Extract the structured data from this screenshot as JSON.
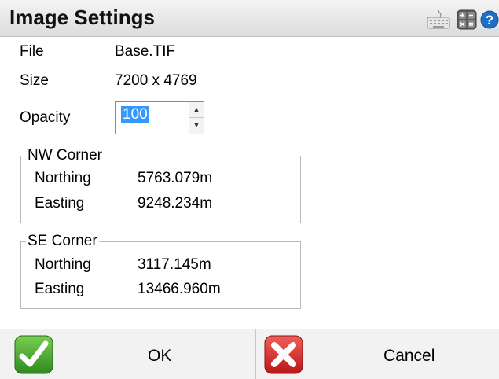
{
  "window": {
    "title": "Image Settings"
  },
  "info": {
    "file_label": "File",
    "file_value": "Base.TIF",
    "size_label": "Size",
    "size_value": "7200 x 4769"
  },
  "opacity": {
    "label": "Opacity",
    "value": "100",
    "up_glyph": "▲",
    "down_glyph": "▼"
  },
  "nw_corner": {
    "title": "NW Corner",
    "northing_label": "Northing",
    "northing_value": "5763.079m",
    "easting_label": "Easting",
    "easting_value": "9248.234m"
  },
  "se_corner": {
    "title": "SE Corner",
    "northing_label": "Northing",
    "northing_value": "3117.145m",
    "easting_label": "Easting",
    "easting_value": "13466.960m"
  },
  "footer": {
    "ok_label": "OK",
    "cancel_label": "Cancel"
  },
  "icons": {
    "keyboard": "keyboard-icon",
    "calculator": "calculator-icon",
    "help": "help-icon",
    "ok": "checkmark-icon",
    "cancel": "x-icon"
  },
  "colors": {
    "ok_green": "#3d9b2b",
    "cancel_red": "#d42424",
    "selection_blue": "#3399ff",
    "help_blue": "#1f6fc7"
  }
}
